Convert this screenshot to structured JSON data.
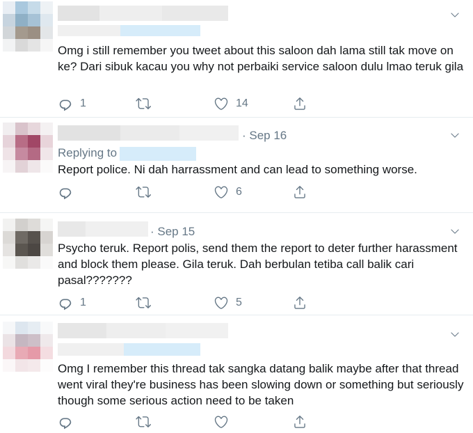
{
  "tweets": [
    {
      "date": "",
      "replying_label": "",
      "text": "Omg i still remember you tweet about this saloon dah lama still tak move on ke? Dari sibuk kacau you why not perbaiki service saloon dulu lmao teruk gila",
      "replies": "1",
      "retweets": "",
      "likes": "14"
    },
    {
      "date": "· Sep 16",
      "replying_label": "Replying to",
      "text": "Report police. Ni dah harrassment and can lead to something worse.",
      "replies": "",
      "retweets": "",
      "likes": "6"
    },
    {
      "date": "· Sep 15",
      "replying_label": "",
      "text": "Psycho teruk. Report polis, send them the report to deter further harassment and block them please. Gila teruk. Dah berbulan tetiba call balik cari pasal???????",
      "replies": "1",
      "retweets": "",
      "likes": "5"
    },
    {
      "date": "",
      "replying_label": "",
      "text": "Omg I remember this thread tak sangka datang balik maybe after that thread went viral they're business has been slowing down or something but seriously though some serious action need to be taken",
      "replies": "",
      "retweets": "",
      "likes": ""
    }
  ],
  "icons": {
    "reply": "reply-icon",
    "retweet": "retweet-icon",
    "like": "heart-icon",
    "share": "share-icon",
    "menu": "chevron-down-icon"
  },
  "colors": {
    "text": "#14171a",
    "secondary": "#657786",
    "divider": "#e6ecf0",
    "link_blur": "#d6ecfa"
  }
}
